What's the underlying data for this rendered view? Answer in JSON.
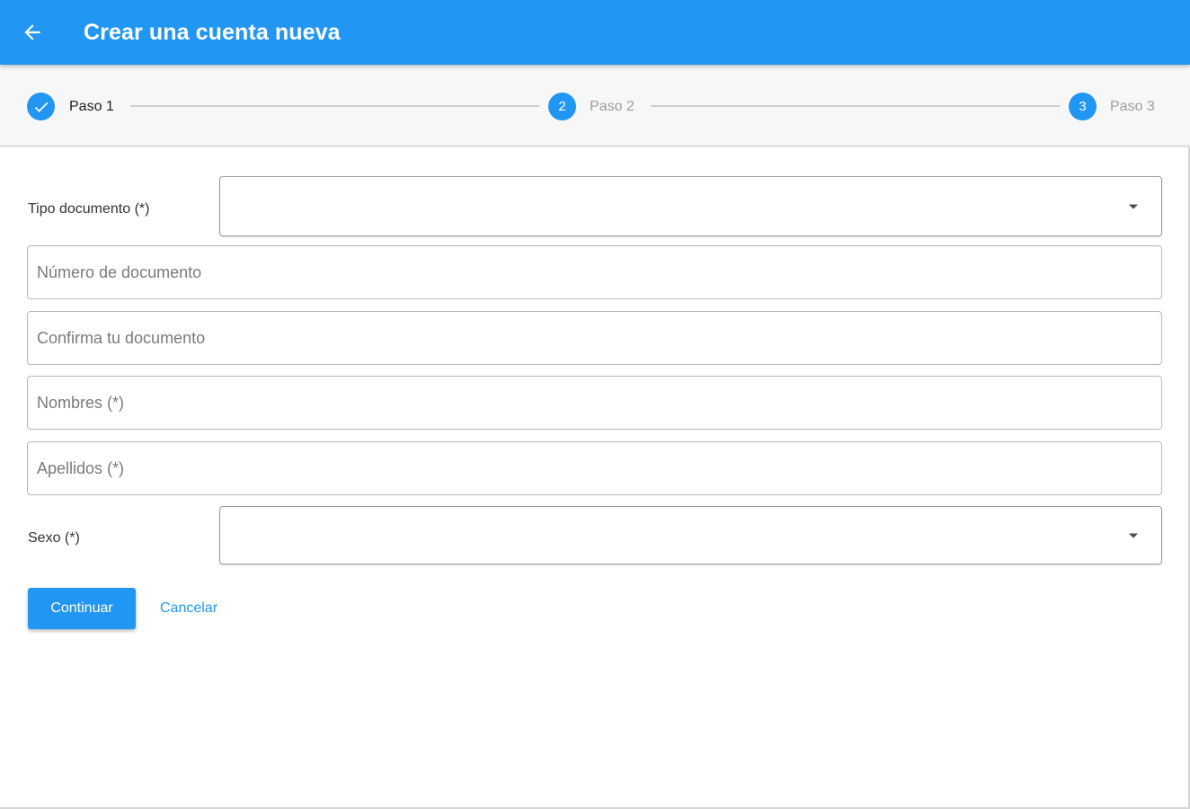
{
  "appbar": {
    "title": "Crear una cuenta nueva",
    "back_icon": "arrow-left-icon",
    "color": "#2196f3"
  },
  "stepper": {
    "steps": [
      {
        "label": "Paso 1",
        "marker": "",
        "state": "completed",
        "icon": "check-icon"
      },
      {
        "label": "Paso 2",
        "marker": "2",
        "state": "inactive"
      },
      {
        "label": "Paso 3",
        "marker": "3",
        "state": "inactive"
      }
    ]
  },
  "form": {
    "tipo_documento": {
      "label": "Tipo documento (*)",
      "value": ""
    },
    "numero_documento": {
      "placeholder": "Número de documento",
      "value": ""
    },
    "confirma_documento": {
      "placeholder": "Confirma tu documento",
      "value": ""
    },
    "nombres": {
      "placeholder": "Nombres (*)",
      "value": ""
    },
    "apellidos": {
      "placeholder": "Apellidos (*)",
      "value": ""
    },
    "sexo": {
      "label": "Sexo (*)",
      "value": ""
    }
  },
  "actions": {
    "continue_label": "Continuar",
    "cancel_label": "Cancelar"
  }
}
